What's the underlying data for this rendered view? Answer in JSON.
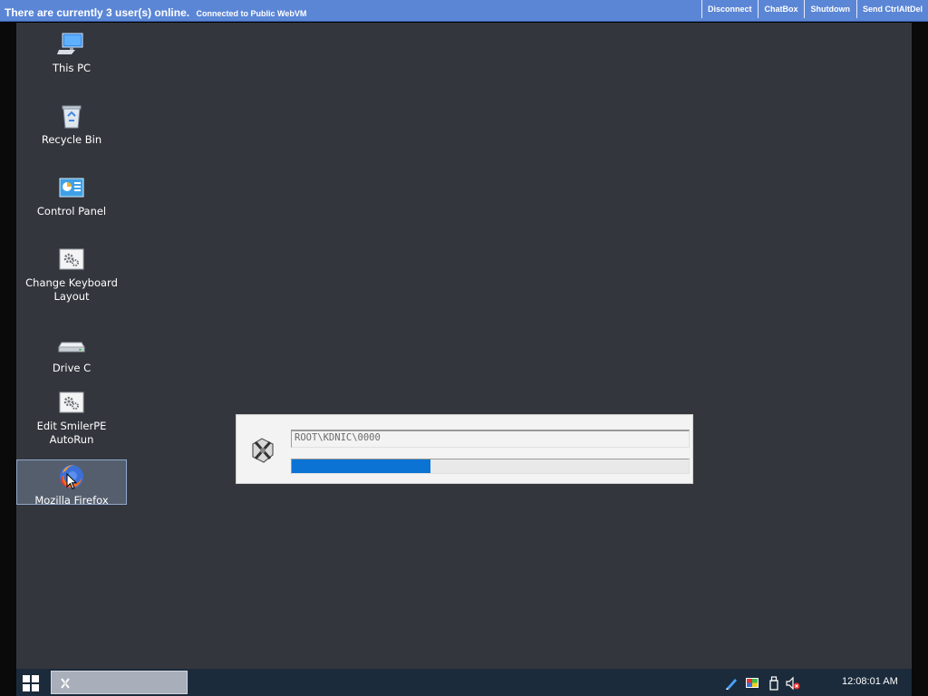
{
  "topbar": {
    "status": "There are currently 3 user(s) online.",
    "connection": "Connected to Public WebVM",
    "buttons": [
      "Disconnect",
      "ChatBox",
      "Shutdown",
      "Send CtrlAltDel"
    ]
  },
  "desktop": {
    "icons": [
      {
        "label": "This PC",
        "icon": "computer-icon"
      },
      {
        "label": "Recycle Bin",
        "icon": "recycle-bin-icon"
      },
      {
        "label": "Control Panel",
        "icon": "control-panel-icon"
      },
      {
        "label": "Change Keyboard Layout",
        "icon": "settings-gears-icon"
      },
      {
        "label": "Drive C",
        "icon": "drive-icon"
      },
      {
        "label": "Edit SmilerPE AutoRun",
        "icon": "settings-gears-icon"
      },
      {
        "label": "Mozilla Firefox",
        "icon": "firefox-icon",
        "selected": true
      }
    ]
  },
  "dialog": {
    "icon": "device-setup-icon",
    "path": "ROOT\\KDNIC\\0000",
    "progress": 0.35
  },
  "taskbar": {
    "start_icon": "windows-start-icon",
    "task_icon": "device-setup-icon",
    "tray_icons": [
      "pen-icon",
      "color-display-icon",
      "usb-drive-icon",
      "speaker-muted-icon"
    ],
    "clock": "12:08:01 AM"
  },
  "colors": {
    "topbar": "#5b86d6",
    "desktop": "#33363d",
    "taskbar": "#1b2b3b",
    "progress_fill": "#0a73d4"
  }
}
